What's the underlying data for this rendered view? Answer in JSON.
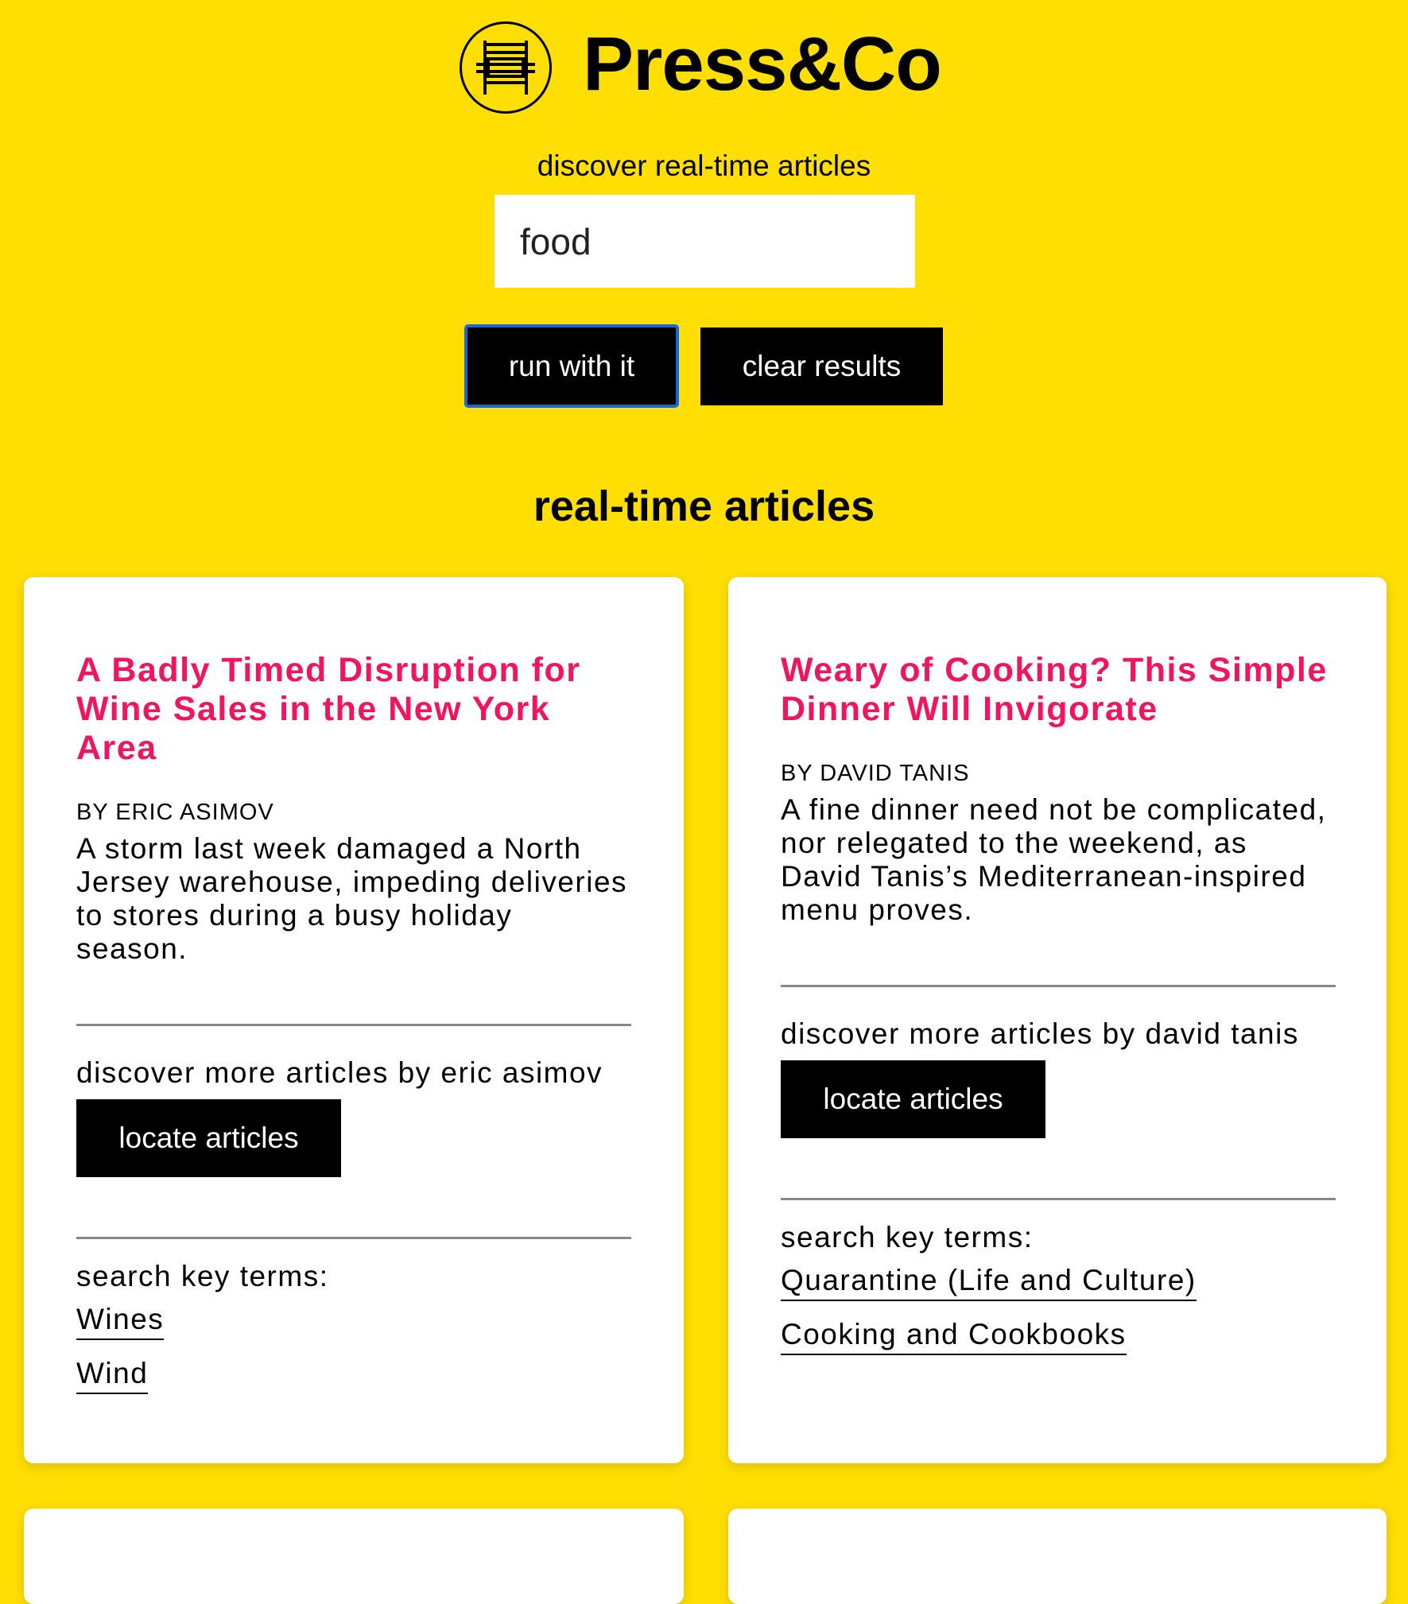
{
  "brand": {
    "name": "Press&Co",
    "logo_icon": "printing-press-icon"
  },
  "search": {
    "tagline": "discover real-time articles",
    "value": "food",
    "run_label": "run with it",
    "clear_label": "clear results"
  },
  "section_title": "real-time articles",
  "colors": {
    "background": "#FFDE03",
    "headline": "#F2145F",
    "button": "#000000",
    "focus_ring": "#1A66D9"
  },
  "articles": [
    {
      "title": "A Badly Timed Disruption for Wine Sales in the New York Area",
      "byline": "BY ERIC ASIMOV",
      "summary": "A storm last week damaged a North Jersey warehouse, impeding deliveries to stores during a busy holiday season.",
      "discover_text": "discover more articles by eric asimov",
      "locate_label": "locate articles",
      "key_terms_label": "search key terms:",
      "key_terms": [
        "Wines",
        "Wind"
      ]
    },
    {
      "title": "Weary of Cooking? This Simple Dinner Will Invigorate",
      "byline": "BY DAVID TANIS",
      "summary": "A fine dinner need not be complicated, nor relegated to the weekend, as David Tanis’s Mediterranean-inspired menu proves.",
      "discover_text": "discover more articles by david tanis",
      "locate_label": "locate articles",
      "key_terms_label": "search key terms:",
      "key_terms": [
        "Quarantine (Life and Culture)",
        "Cooking and Cookbooks"
      ]
    }
  ]
}
